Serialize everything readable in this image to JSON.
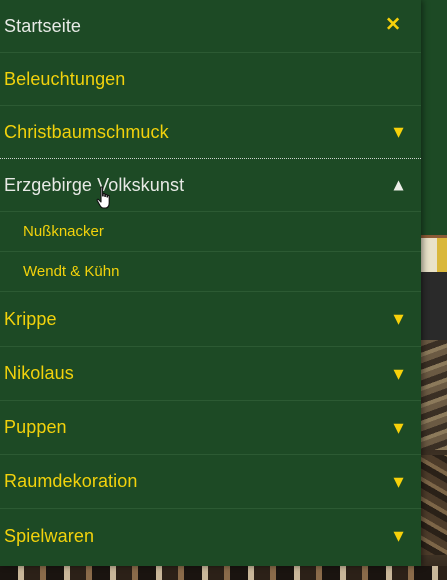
{
  "menu": {
    "home_label": "Startseite",
    "items": [
      {
        "label": "Beleuchtungen"
      },
      {
        "label": "Christbaumschmuck",
        "arrow": "▼"
      },
      {
        "label": "Erzgebirge Volkskunst",
        "arrow": "▲",
        "expanded": true,
        "children": [
          {
            "label": "Nußknacker"
          },
          {
            "label": "Wendt & Kühn"
          }
        ]
      },
      {
        "label": "Krippe",
        "arrow": "▼"
      },
      {
        "label": "Nikolaus",
        "arrow": "▼"
      },
      {
        "label": "Puppen",
        "arrow": "▼"
      },
      {
        "label": "Raumdekoration",
        "arrow": "▼"
      },
      {
        "label": "Spielwaren",
        "arrow": "▼"
      }
    ]
  },
  "icons": {
    "close": "close-icon",
    "expand": "chevron-down-icon",
    "collapse": "chevron-up-icon",
    "cursor": "hand-pointer-icon"
  },
  "colors": {
    "menu_bg": "#1d4a25",
    "accent": "#f2d20c",
    "text_light": "#e8eae6"
  }
}
